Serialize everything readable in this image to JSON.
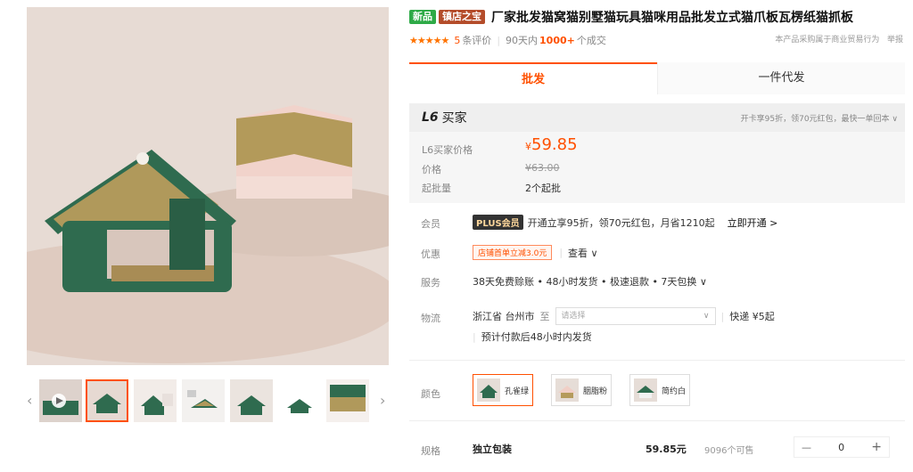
{
  "title": {
    "tag_new": "新品",
    "tag_shop": "镇店之宝",
    "text": "厂家批发猫窝猫别墅猫玩具猫咪用品批发立式猫爪板瓦楞纸猫抓板"
  },
  "meta": {
    "stars": "★★★★★",
    "review_count": "5",
    "review_label": "条评价",
    "days_label": "90天内",
    "sold_count": "1000+",
    "sold_label": "个成交",
    "disclaimer": "本产品采购属于商业贸易行为",
    "report": "举报"
  },
  "tabs": {
    "active": "批发",
    "other": "一件代发"
  },
  "pricebox": {
    "level": "L6",
    "buyer": "买家",
    "promo": "开卡享95折，领70元红包，最快一单回本 ∨",
    "l6_price_label": "L6买家价格",
    "l6_price_symbol": "¥",
    "l6_price": "59.85",
    "price_label": "价格",
    "price": "¥63.00",
    "moq_label": "起批量",
    "moq": "2个起批"
  },
  "member": {
    "label": "会员",
    "badge": "PLUS会员",
    "text": "开通立享95折，领70元红包，月省1210起",
    "action": "立即开通 >"
  },
  "discount": {
    "label": "优惠",
    "coupon": "店铺首单立减3.0元",
    "view": "查看 ∨"
  },
  "service": {
    "label": "服务",
    "text": "38天免费赊账 • 48小时发货 • 极速退款 • 7天包换 ∨"
  },
  "logistics": {
    "label": "物流",
    "from": "浙江省 台州市",
    "to": "至",
    "placeholder": "请选择",
    "chevron": "∨",
    "express": "快递 ¥5起",
    "note": "预计付款后48小时内发货"
  },
  "colors": {
    "label": "颜色",
    "options": [
      "孔雀绿",
      "胭脂粉",
      "简约白"
    ]
  },
  "spec": {
    "label": "规格",
    "name": "独立包装",
    "price": "59.85元",
    "stock": "9096个可售",
    "minus": "—",
    "qty": "0",
    "plus": "+"
  },
  "gallery": {
    "prev": "‹",
    "next": "›"
  },
  "palette": {
    "accent": "#ff5000",
    "green": "#2f6b4f",
    "pink": "#efc9c0"
  }
}
